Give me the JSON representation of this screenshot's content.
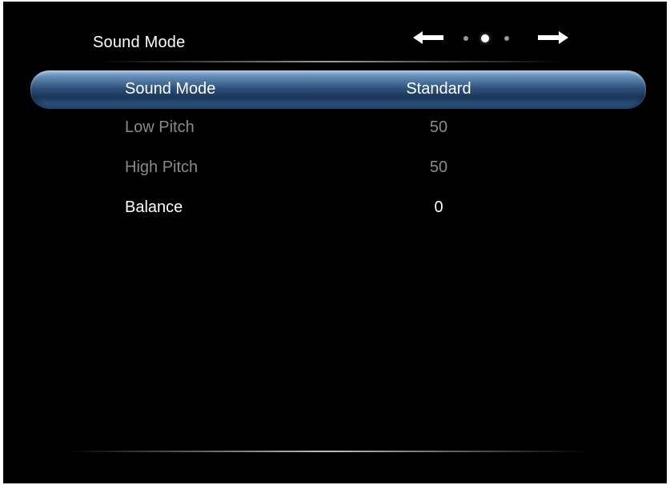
{
  "header": {
    "title": "Sound Mode"
  },
  "pager": {
    "left_icon": "arrow-left-icon",
    "right_icon": "arrow-right-icon",
    "page_count": 3,
    "active_page": 2
  },
  "menu": {
    "items": [
      {
        "label": "Sound Mode",
        "value": "Standard",
        "state": "selected"
      },
      {
        "label": "Low Pitch",
        "value": "50",
        "state": "disabled"
      },
      {
        "label": "High Pitch",
        "value": "50",
        "state": "disabled"
      },
      {
        "label": "Balance",
        "value": "0",
        "state": "enabled"
      }
    ]
  },
  "colors": {
    "background": "#000000",
    "text_enabled": "#ffffff",
    "text_disabled": "#8a8a8a",
    "highlight": "#2c4f78"
  }
}
